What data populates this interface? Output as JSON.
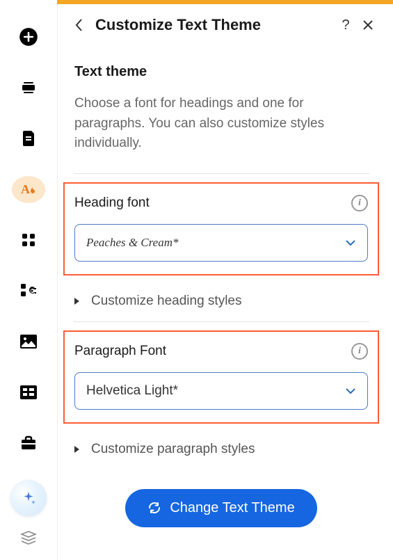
{
  "header": {
    "title": "Customize Text Theme"
  },
  "intro": {
    "title": "Text theme",
    "description": "Choose a font for headings and one for paragraphs. You can also customize styles individually."
  },
  "heading_font": {
    "label": "Heading font",
    "value": "Peaches & Cream*",
    "customize_label": "Customize heading styles"
  },
  "paragraph_font": {
    "label": "Paragraph Font",
    "value": "Helvetica Light*",
    "customize_label": "Customize paragraph styles"
  },
  "change_button": "Change Text Theme"
}
